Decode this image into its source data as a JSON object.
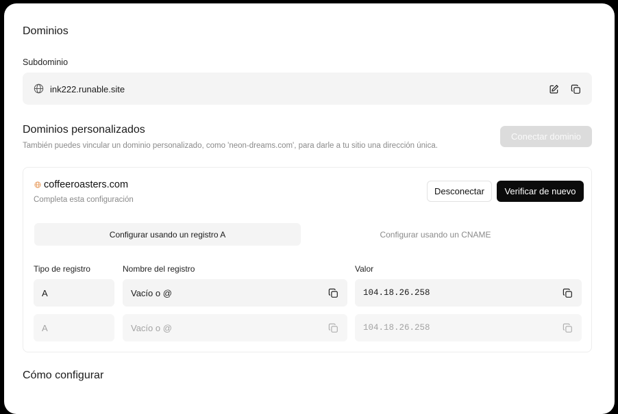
{
  "domains": {
    "title": "Dominios",
    "subdomain_label": "Subdominio",
    "subdomain_value": "ink222.runable.site"
  },
  "custom": {
    "title": "Dominios personalizados",
    "description": "También puedes vincular un dominio personalizado, como 'neon-dreams.com', para darle a tu sitio una dirección única.",
    "connect_label": "Conectar dominio"
  },
  "domain_card": {
    "domain": "coffeeroasters.com",
    "status": "Completa esta configuración",
    "disconnect_label": "Desconectar",
    "verify_label": "Verificar de nuevo",
    "tabs": [
      {
        "label": "Configurar usando un registro A",
        "active": true
      },
      {
        "label": "Configurar usando un CNAME",
        "active": false
      }
    ],
    "columns": {
      "type": "Tipo de registro",
      "name": "Nombre del registro",
      "value": "Valor"
    },
    "records": [
      {
        "type": "A",
        "name": "Vacío o @",
        "value": "104.18.26.258"
      },
      {
        "type": "A",
        "name": "Vacío o @",
        "value": "104.18.26.258"
      }
    ]
  },
  "howto": {
    "title": "Cómo configurar"
  },
  "colors": {
    "primary_button": "#0b0b0b",
    "disabled_button": "#dcdcdc",
    "field_bg": "#f4f4f4",
    "domain_dot": "#e9a36a"
  },
  "icons": {
    "globe": "globe-icon",
    "edit": "pencil-square-icon",
    "copy": "copy-icon"
  }
}
